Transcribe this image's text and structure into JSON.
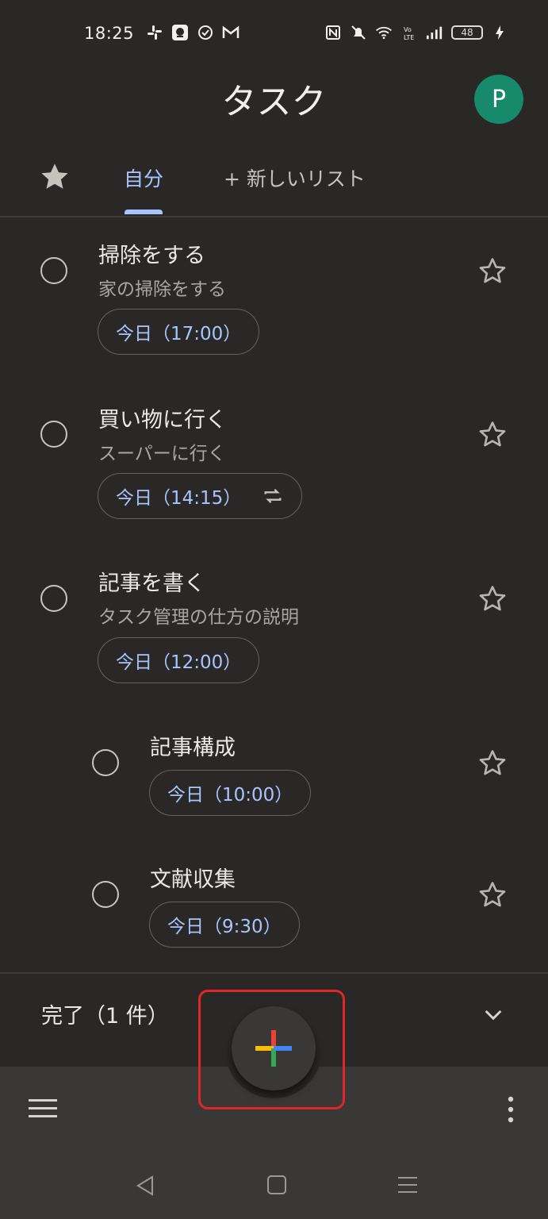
{
  "status_bar": {
    "time": "18:25",
    "left_icons": [
      "slack-icon",
      "app-icon",
      "check-circle-icon",
      "gmail-icon"
    ],
    "right_icons": [
      "nfc-icon",
      "mute-icon",
      "wifi-icon",
      "volte-icon",
      "signal-icon",
      "battery-icon",
      "charging-icon"
    ],
    "battery_level": "48"
  },
  "header": {
    "title": "タスク",
    "avatar_initial": "P",
    "avatar_color": "#178a6c"
  },
  "tabs": {
    "starred_icon": "star-icon",
    "active_tab": "自分",
    "new_list": "+ 新しいリスト"
  },
  "tasks": [
    {
      "title": "掃除をする",
      "description": "家の掃除をする",
      "due": "今日（17:00）",
      "repeat": false,
      "indent": 0
    },
    {
      "title": "買い物に行く",
      "description": "スーパーに行く",
      "due": "今日（14:15）",
      "repeat": true,
      "indent": 0
    },
    {
      "title": "記事を書く",
      "description": "タスク管理の仕方の説明",
      "due": "今日（12:00）",
      "repeat": false,
      "indent": 0
    },
    {
      "title": "記事構成",
      "description": "",
      "due": "今日（10:00）",
      "repeat": false,
      "indent": 1
    },
    {
      "title": "文献収集",
      "description": "",
      "due": "今日（9:30）",
      "repeat": false,
      "indent": 1
    }
  ],
  "completed": {
    "label": "完了（1 件）"
  },
  "fab": {
    "icon": "add-icon",
    "colors": [
      "#ea4335",
      "#fbbc04",
      "#34a853",
      "#4285f4"
    ]
  },
  "highlight_color": "#e0262b",
  "accent_color": "#a8c5ff"
}
